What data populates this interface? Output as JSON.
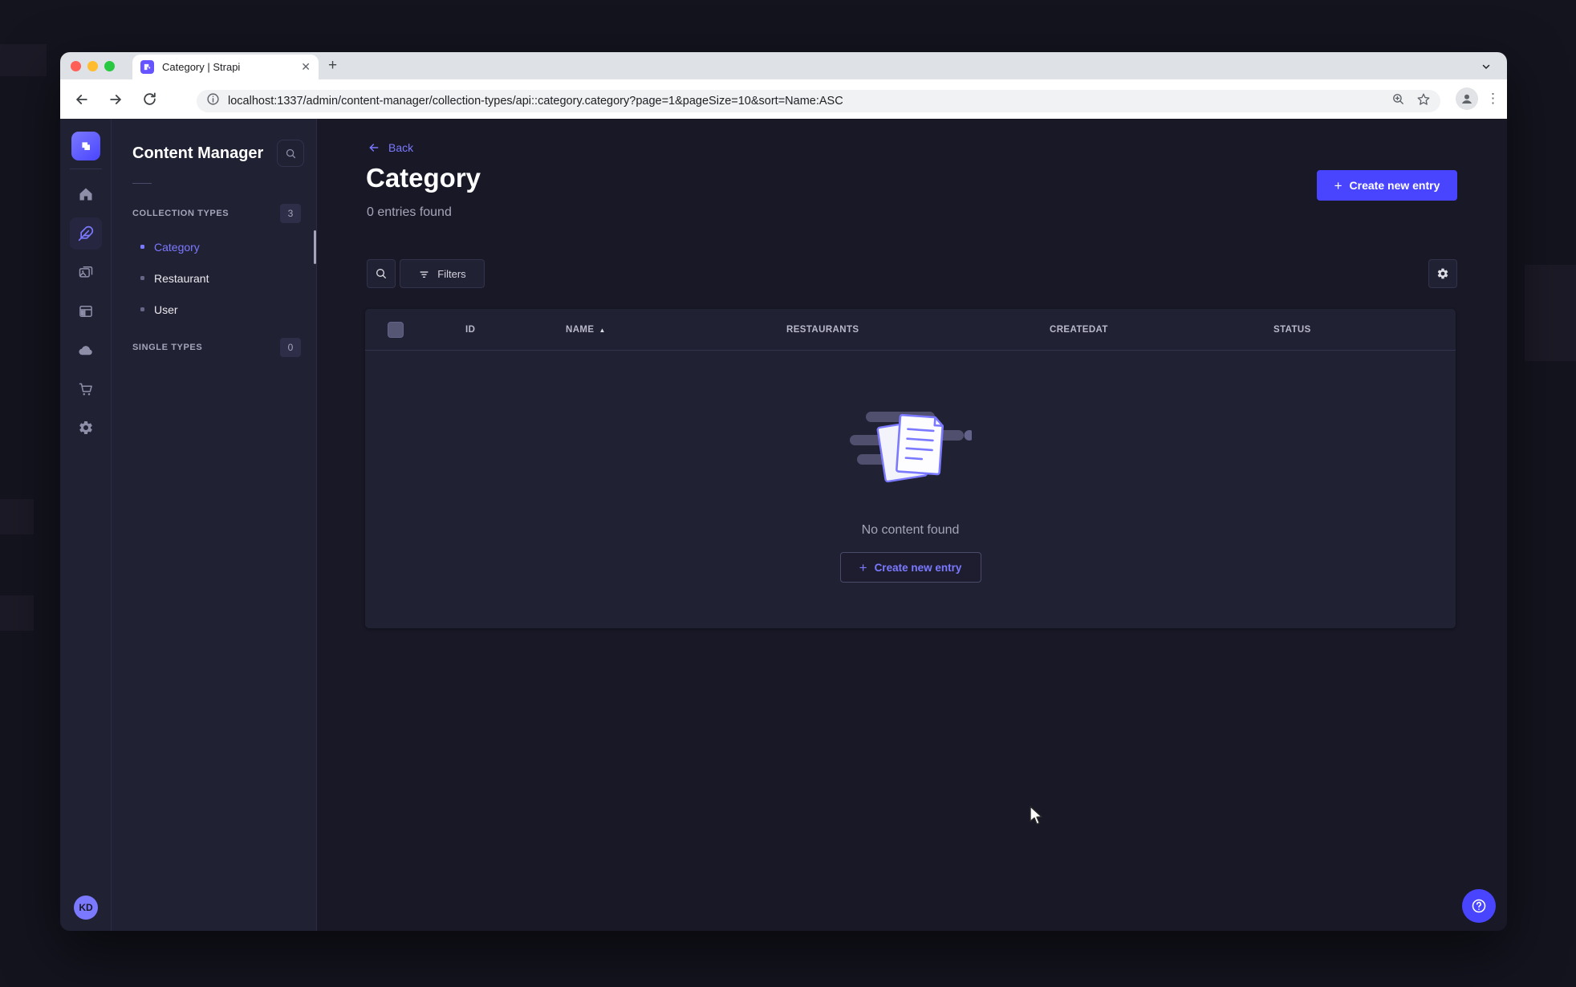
{
  "browser": {
    "tab_title": "Category | Strapi",
    "url": "localhost:1337/admin/content-manager/collection-types/api::category.category?page=1&pageSize=10&sort=Name:ASC"
  },
  "rail_icons": [
    "strapi-logo",
    "home",
    "content-manager-feather",
    "media-library",
    "content-type-builder",
    "deploy-cloud",
    "marketplace-cart",
    "settings-gear"
  ],
  "subnav": {
    "title": "Content Manager",
    "sections": [
      {
        "label": "COLLECTION TYPES",
        "badge": "3",
        "items": [
          {
            "label": "Category",
            "active": true
          },
          {
            "label": "Restaurant",
            "active": false
          },
          {
            "label": "User",
            "active": false
          }
        ]
      },
      {
        "label": "SINGLE TYPES",
        "badge": "0",
        "items": []
      }
    ]
  },
  "main": {
    "back_label": "Back",
    "title": "Category",
    "subtitle": "0 entries found",
    "create_button_label": "Create new entry",
    "filters_label": "Filters",
    "table": {
      "columns": [
        "ID",
        "NAME",
        "RESTAURANTS",
        "CREATEDAT",
        "STATUS"
      ],
      "sorted_column": "NAME",
      "sort_direction": "asc",
      "rows": []
    },
    "empty_state": {
      "message": "No content found",
      "cta_label": "Create new entry"
    }
  },
  "user": {
    "initials": "KD"
  },
  "colors": {
    "primary": "#4945ff",
    "primary_light": "#7b79ff",
    "app_background": "#181826",
    "surface": "#212134",
    "text_muted": "#a5a5ba"
  }
}
